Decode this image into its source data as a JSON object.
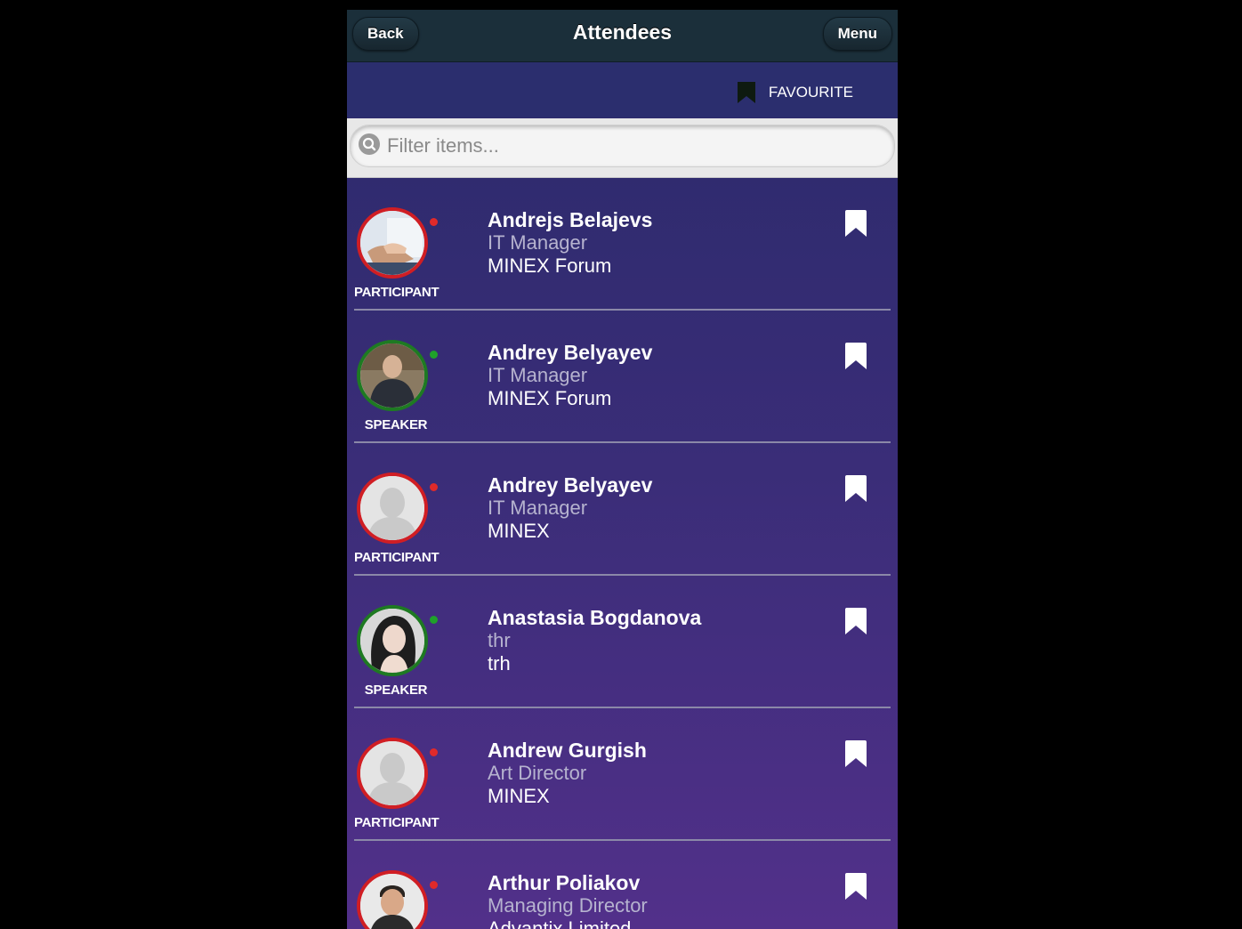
{
  "header": {
    "back_label": "Back",
    "title": "Attendees",
    "menu_label": "Menu"
  },
  "favourite": {
    "label": "FAVOURITE"
  },
  "filter": {
    "placeholder": "Filter items..."
  },
  "attendees": [
    {
      "name": "Andrejs Belajevs",
      "job": "IT Manager",
      "company": "MINEX Forum",
      "role": "PARTICIPANT",
      "status": "red",
      "avatar": "photo-handshake"
    },
    {
      "name": "Andrey Belyayev",
      "job": "IT Manager",
      "company": "MINEX Forum",
      "role": "SPEAKER",
      "status": "green",
      "avatar": "photo-man"
    },
    {
      "name": "Andrey Belyayev",
      "job": "IT Manager",
      "company": "MINEX",
      "role": "PARTICIPANT",
      "status": "red",
      "avatar": "placeholder"
    },
    {
      "name": "Anastasia Bogdanova",
      "job": "thr",
      "company": "trh",
      "role": "SPEAKER",
      "status": "green",
      "avatar": "photo-woman"
    },
    {
      "name": "Andrew Gurgish",
      "job": "Art Director",
      "company": "MINEX",
      "role": "PARTICIPANT",
      "status": "red",
      "avatar": "placeholder"
    },
    {
      "name": "Arthur Poliakov",
      "job": "Managing Director",
      "company": "Advantix Limited",
      "role": "",
      "status": "red",
      "avatar": "photo-man-smiling"
    }
  ],
  "colors": {
    "header_bg": "#1b2f3a",
    "list_bg_top": "#2a2a6a",
    "list_bg_bottom": "#52308a",
    "participant_ring": "#d01e24",
    "speaker_ring": "#1e7a22"
  }
}
